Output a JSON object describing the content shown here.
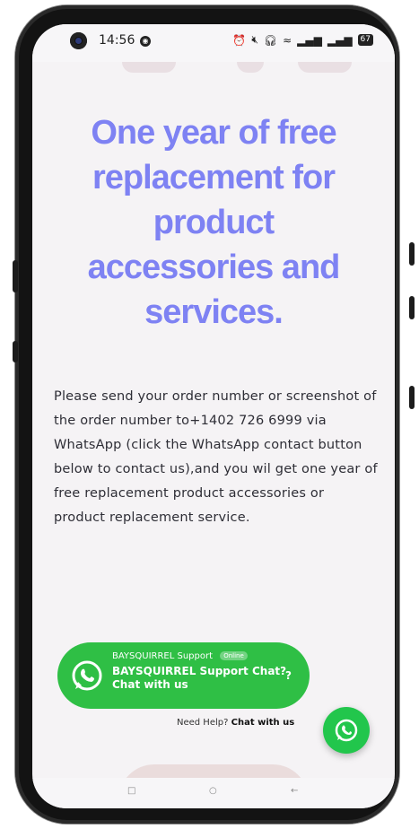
{
  "status_bar": {
    "time": "14:56",
    "icons": [
      "alarm-icon",
      "mute-icon",
      "headset-icon",
      "wifi-icon",
      "signal-icon",
      "signal-icon-2"
    ],
    "battery": "67"
  },
  "headline": "One year of free replacement for product accessories and services.",
  "body_text": "Please send your order number or screenshot of the order number to+1402 726 6999 via WhatsApp (click the WhatsApp contact button below to contact us),and you wil get one year of free replacement product accessories or product  replacement service.",
  "chat_widget": {
    "support_name": "BAYSQUIRREL Support",
    "online_label": "Online",
    "message": "BAYSQUIRREL Support Chat? Chat with us",
    "question_mark": "?",
    "need_help_prefix": "Need Help?",
    "need_help_link": "Chat with us"
  },
  "nav_bar": {
    "recents": "□",
    "home": "○",
    "back": "←"
  },
  "colors": {
    "headline": "#7e82f3",
    "whatsapp_green": "#2fbf45",
    "background": "#f5f3f5"
  }
}
